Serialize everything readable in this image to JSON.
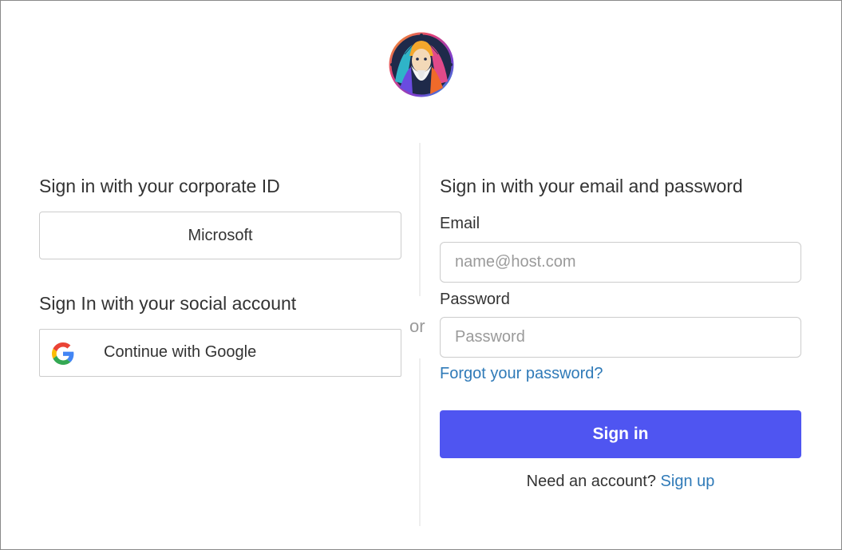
{
  "logo": {
    "icon": "wizard-avatar-logo"
  },
  "corporate": {
    "heading": "Sign in with your corporate ID",
    "provider_label": "Microsoft"
  },
  "social": {
    "heading": "Sign In with your social account",
    "google_label": "Continue with Google",
    "google_icon": "google-g-icon"
  },
  "divider": {
    "or_text": "or"
  },
  "email_form": {
    "heading": "Sign in with your email and password",
    "email_label": "Email",
    "email_placeholder": "name@host.com",
    "password_label": "Password",
    "password_placeholder": "Password",
    "forgot_link": "Forgot your password?",
    "signin_label": "Sign in",
    "signup_prompt": "Need an account?",
    "signup_link": "Sign up"
  },
  "colors": {
    "primary_button": "#4f55f1",
    "link": "#2f7ab8",
    "text": "#333333",
    "placeholder": "#9a9a9a"
  }
}
